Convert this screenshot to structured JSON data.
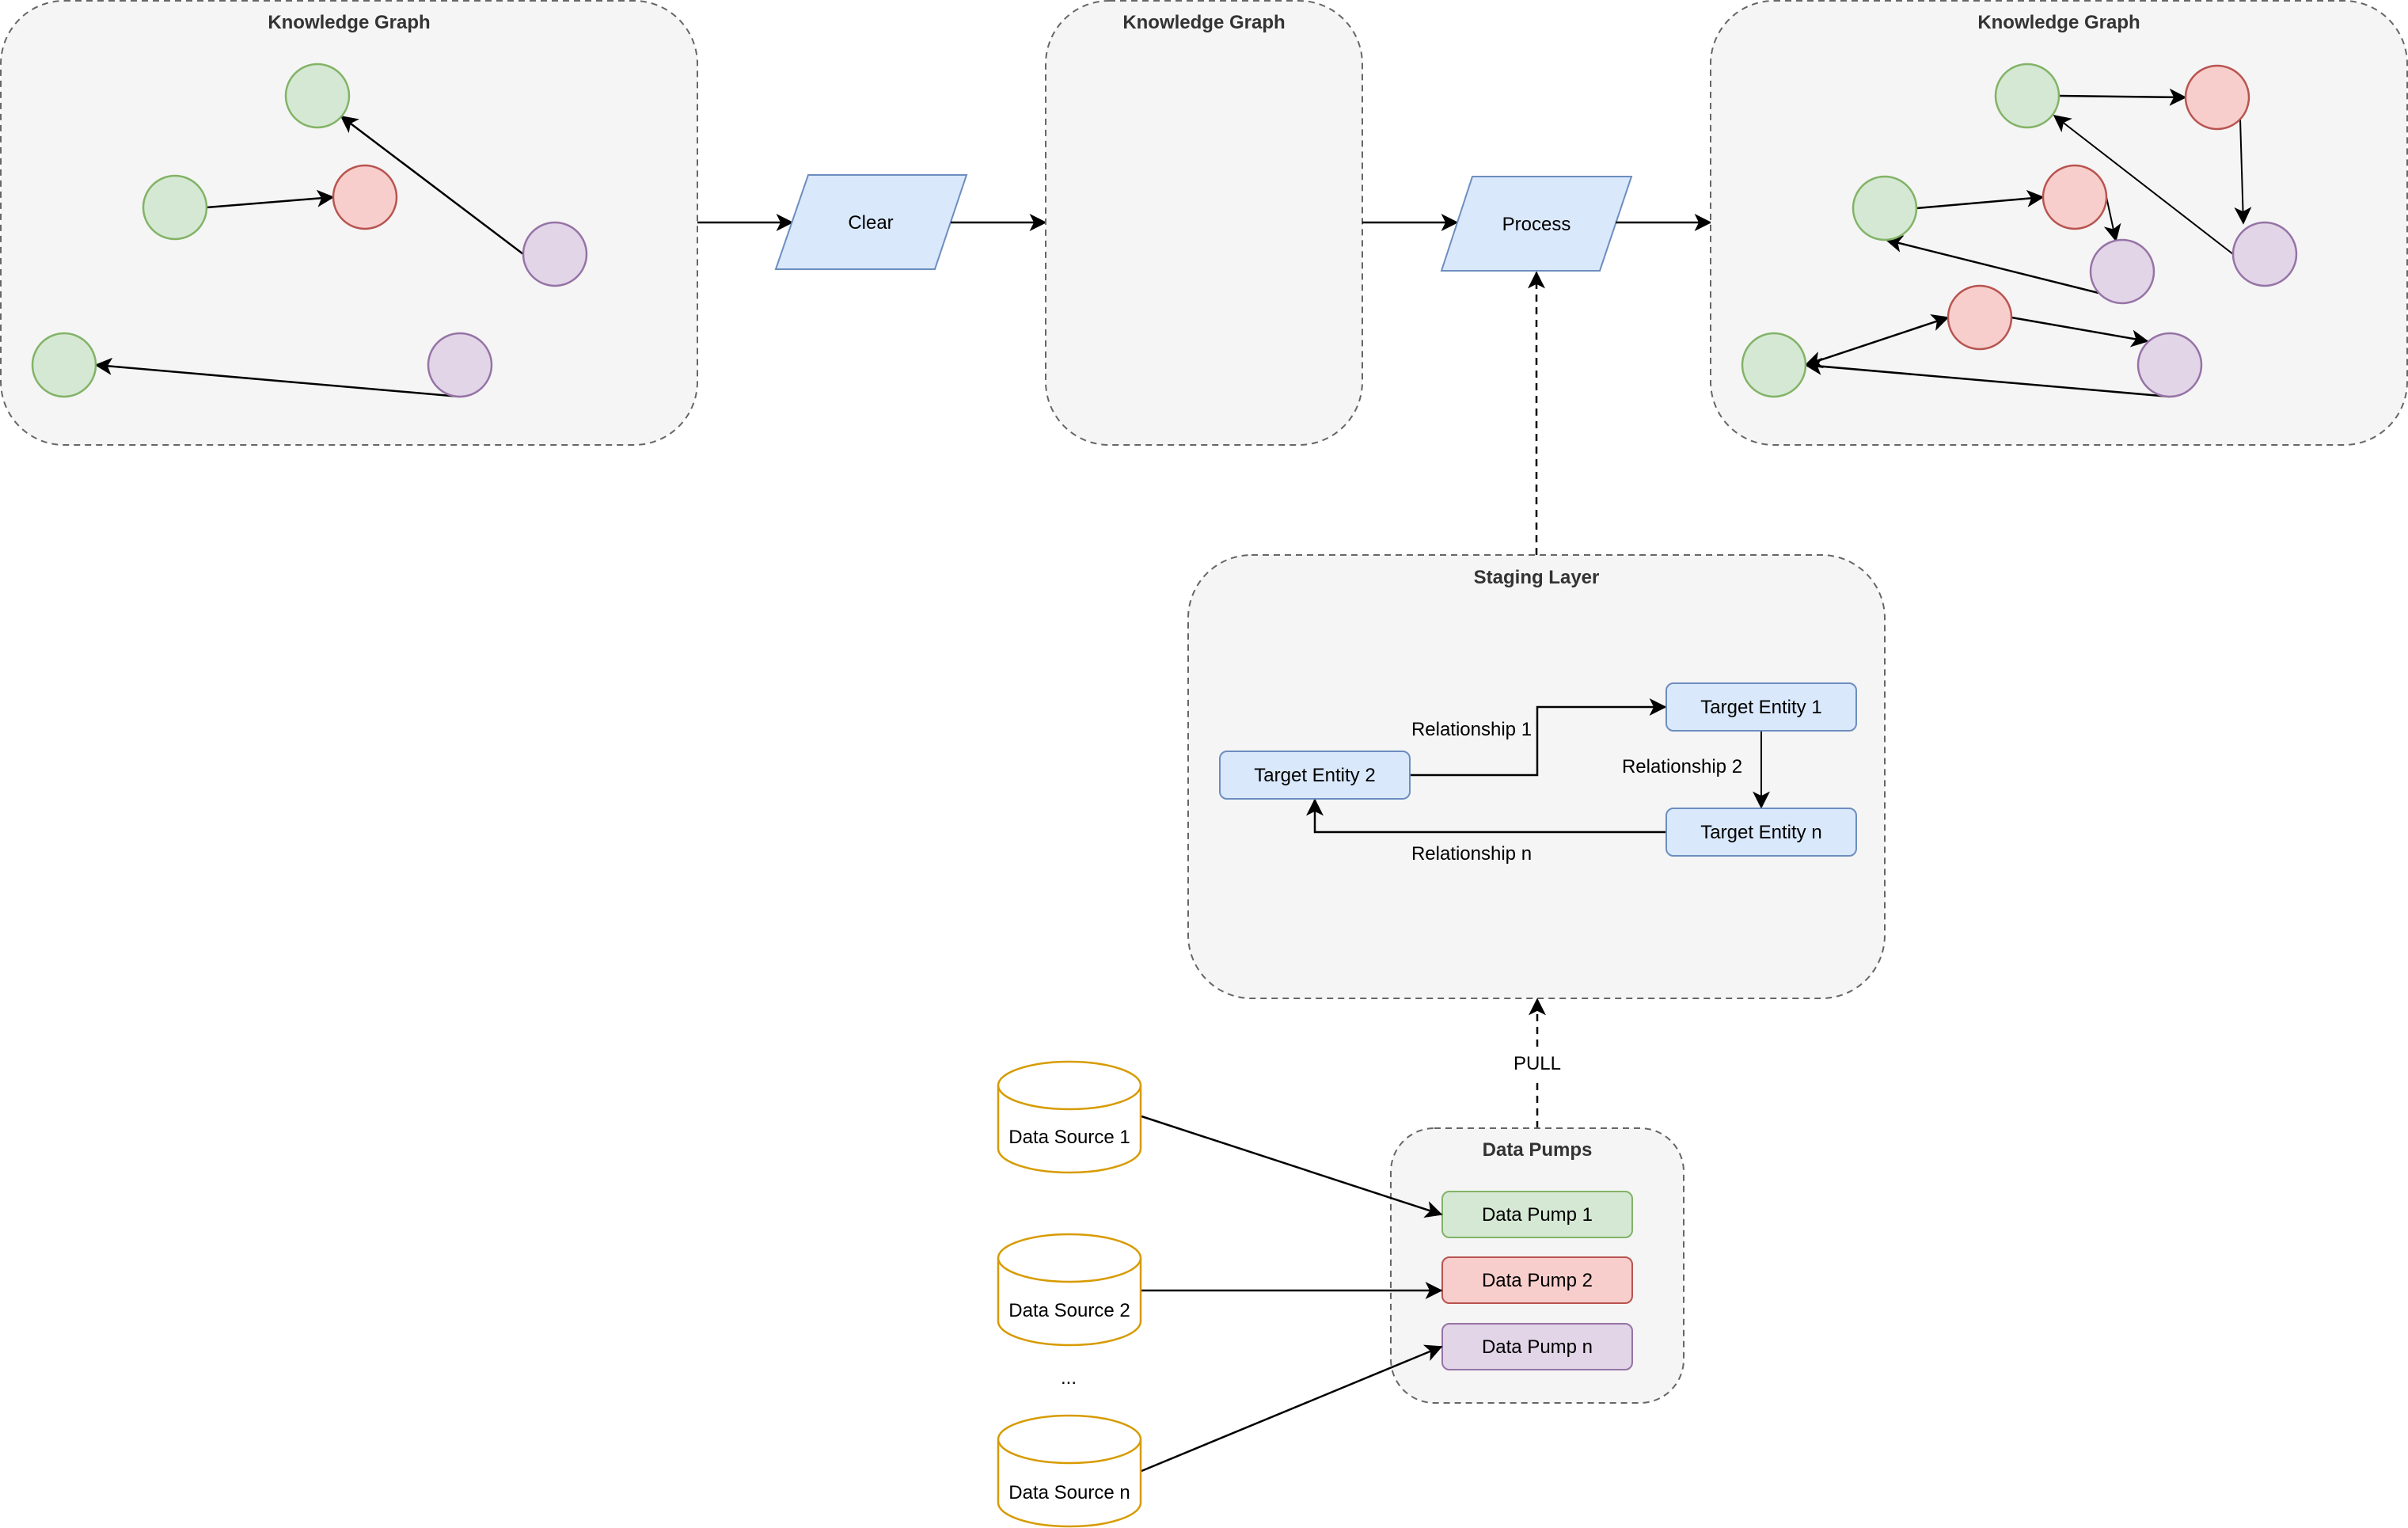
{
  "colors": {
    "container_fill": "#f5f5f5",
    "container_stroke": "#666666",
    "title_text": "#333333",
    "process_fill": "#dae8fc",
    "process_stroke": "#6c8ebf",
    "green_fill": "#d5e8d4",
    "green_stroke": "#82b366",
    "red_fill": "#f8cecc",
    "red_stroke": "#b85450",
    "purple_fill": "#e1d5e7",
    "purple_stroke": "#9673a6",
    "source_stroke": "#d79b00"
  },
  "knowledge_graph_before": {
    "title": "Knowledge Graph",
    "nodes": [
      "green",
      "green",
      "red",
      "purple",
      "green",
      "purple"
    ]
  },
  "knowledge_graph_cleared": {
    "title": "Knowledge Graph"
  },
  "knowledge_graph_after": {
    "title": "Knowledge Graph",
    "nodes": [
      "green",
      "red",
      "green",
      "red",
      "purple",
      "purple",
      "red",
      "green",
      "purple"
    ]
  },
  "steps": {
    "clear": "Clear",
    "process": "Process"
  },
  "staging_layer": {
    "title": "Staging Layer",
    "entities": {
      "entity_1": "Target Entity 1",
      "entity_2": "Target Entity 2",
      "entity_n": "Target Entity n"
    },
    "relationships": {
      "rel_1": "Relationship 1",
      "rel_2": "Relationship 2",
      "rel_n": "Relationship n"
    }
  },
  "pull_label": "PULL",
  "data_pumps": {
    "title": "Data Pumps",
    "pumps": [
      "Data Pump 1",
      "Data Pump 2",
      "Data Pump n"
    ]
  },
  "data_sources": {
    "items": [
      "Data Source 1",
      "Data Source 2",
      "Data Source n"
    ],
    "ellipsis": "..."
  }
}
